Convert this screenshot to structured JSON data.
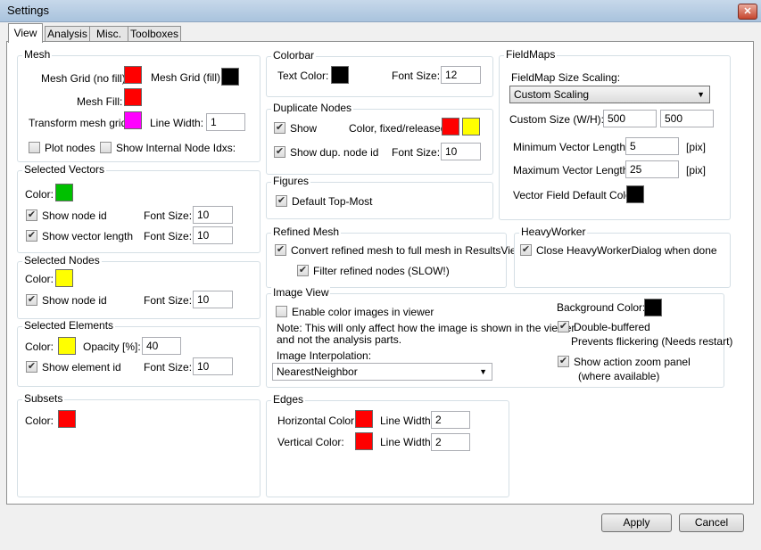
{
  "window": {
    "title": "Settings",
    "close_glyph": "✕"
  },
  "tabs": [
    "View",
    "Analysis",
    "Misc.",
    "Toolboxes"
  ],
  "check_glyph": "✔",
  "colors": {
    "red": "#ff0000",
    "black": "#000000",
    "magenta": "#ff00ff",
    "green": "#00c000",
    "yellow": "#ffff00"
  },
  "mesh": {
    "title": "Mesh",
    "grid_nofill_label": "Mesh Grid (no fill):",
    "grid_fill_label": "Mesh Grid (fill):",
    "fill_label": "Mesh Fill:",
    "transform_label": "Transform mesh grid:",
    "line_width_label": "Line Width:",
    "line_width_value": "1",
    "plot_nodes_label": "Plot nodes",
    "plot_nodes_checked": false,
    "show_internal_label": "Show Internal Node Idxs:",
    "show_internal_checked": false
  },
  "selected_vectors": {
    "title": "Selected Vectors",
    "color_label": "Color:",
    "show_node_id_label": "Show node id",
    "show_vector_length_label": "Show vector length",
    "font_size_label": "Font Size:",
    "font_size_1": "10",
    "font_size_2": "10"
  },
  "selected_nodes": {
    "title": "Selected Nodes",
    "color_label": "Color:",
    "show_node_id_label": "Show node id",
    "font_size_label": "Font Size:",
    "font_size": "10"
  },
  "selected_elements": {
    "title": "Selected Elements",
    "color_label": "Color:",
    "opacity_label": "Opacity [%]:",
    "opacity": "40",
    "show_element_id_label": "Show element id",
    "font_size_label": "Font Size:",
    "font_size": "10"
  },
  "subsets": {
    "title": "Subsets",
    "color_label": "Color:"
  },
  "colorbar": {
    "title": "Colorbar",
    "text_color_label": "Text Color:",
    "font_size_label": "Font Size:",
    "font_size": "12"
  },
  "duplicate_nodes": {
    "title": "Duplicate Nodes",
    "show_label": "Show",
    "color_label": "Color, fixed/released",
    "show_dup_label": "Show dup. node id",
    "font_size_label": "Font Size:",
    "font_size": "10"
  },
  "figures": {
    "title": "Figures",
    "default_top_most_label": "Default Top-Most"
  },
  "refined_mesh": {
    "title": "Refined Mesh",
    "convert_label": "Convert refined mesh to full mesh in ResultsView",
    "filter_label": "Filter refined nodes (SLOW!)"
  },
  "image_view": {
    "title": "Image View",
    "enable_color_label": "Enable color images in viewer",
    "enable_color_checked": false,
    "note_line1": "Note: This will only affect how the image is shown in the viewer",
    "note_line2": "and not the analysis parts.",
    "interp_label": "Image Interpolation:",
    "interp_value": "NearestNeighbor",
    "bg_color_label": "Background Color:",
    "double_buffered_label": "Double-buffered",
    "double_buffered_note": "Prevents flickering (Needs restart)",
    "zoom_panel_label": "Show action zoom panel",
    "zoom_panel_note": "(where available)"
  },
  "edges": {
    "title": "Edges",
    "horizontal_color_label": "Horizontal Color:",
    "vertical_color_label": "Vertical Color:",
    "line_width_label": "Line Width:",
    "h_line_width": "2",
    "v_line_width": "2"
  },
  "fieldmaps": {
    "title": "FieldMaps",
    "size_scaling_label": "FieldMap Size Scaling:",
    "size_scaling_value": "Custom Scaling",
    "custom_size_label": "Custom Size (W/H):",
    "custom_w": "500",
    "custom_h": "500",
    "min_vec_label": "Minimum Vector Length:",
    "min_vec": "5",
    "max_vec_label": "Maximum Vector Length:",
    "max_vec": "25",
    "unit": "[pix]",
    "default_color_label": "Vector Field Default Color:"
  },
  "heavyworker": {
    "title": "HeavyWorker",
    "close_label": "Close HeavyWorkerDialog when done"
  },
  "buttons": {
    "apply": "Apply",
    "cancel": "Cancel"
  }
}
